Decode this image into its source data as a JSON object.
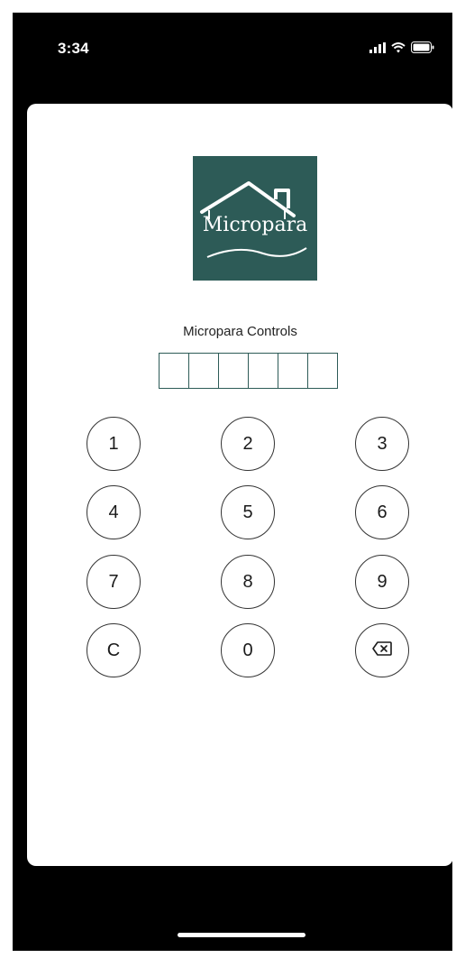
{
  "status_bar": {
    "time": "3:34",
    "icons": [
      "cellular-signal-icon",
      "wifi-icon",
      "battery-icon"
    ]
  },
  "logo": {
    "text": "Micropara",
    "background": "#2d5b57"
  },
  "app_title": "Micropara Controls",
  "pin": {
    "length": 6,
    "values": [
      "",
      "",
      "",
      "",
      "",
      ""
    ]
  },
  "keypad": {
    "keys": [
      "1",
      "2",
      "3",
      "4",
      "5",
      "6",
      "7",
      "8",
      "9",
      "C",
      "0",
      "backspace-icon"
    ]
  },
  "colors": {
    "accent": "#2d5b57",
    "frame": "#000000",
    "surface": "#ffffff"
  }
}
